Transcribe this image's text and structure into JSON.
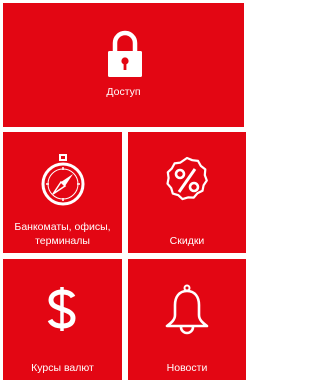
{
  "colors": {
    "tile": "#e30613",
    "text": "#ffffff",
    "background": "#ffffff"
  },
  "tiles": {
    "access": {
      "label": "Доступ",
      "icon": "lock-icon"
    },
    "atm": {
      "label_line1": "Банкоматы, офисы,",
      "label_line2": "терминалы",
      "icon": "compass-icon"
    },
    "discounts": {
      "label": "Скидки",
      "icon": "percent-badge-icon"
    },
    "rates": {
      "label": "Курсы валют",
      "icon": "dollar-icon"
    },
    "news": {
      "label": "Новости",
      "icon": "bell-icon"
    }
  }
}
